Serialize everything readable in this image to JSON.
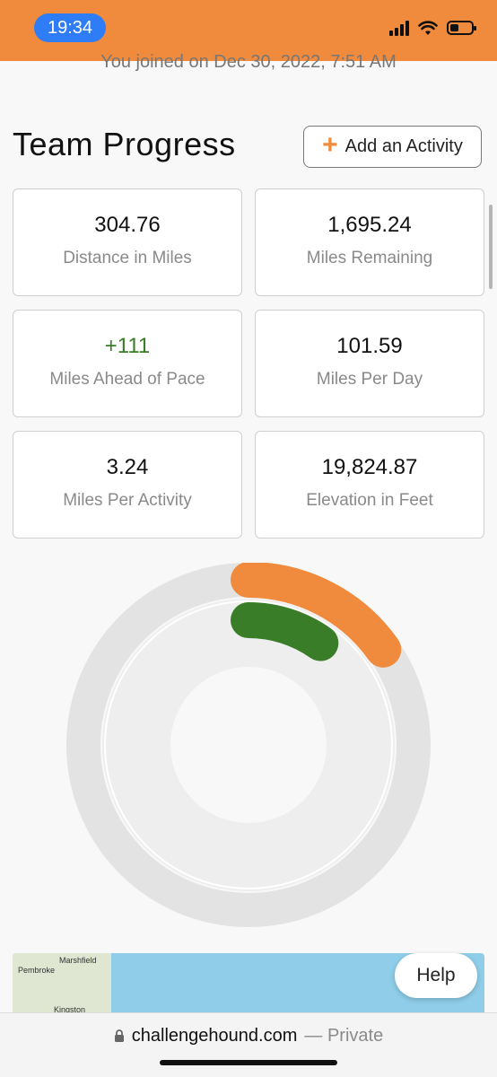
{
  "status_bar": {
    "time": "19:34"
  },
  "header": {
    "joined_text": "You joined on Dec 30, 2022, 7:51 AM"
  },
  "section": {
    "title": "Team Progress",
    "add_activity_label": "Add an Activity"
  },
  "stats": [
    {
      "value": "304.76",
      "label": "Distance in Miles"
    },
    {
      "value": "1,695.24",
      "label": "Miles Remaining"
    },
    {
      "value": "+111",
      "label": "Miles Ahead of Pace"
    },
    {
      "value": "101.59",
      "label": "Miles Per Day"
    },
    {
      "value": "3.24",
      "label": "Miles Per Activity"
    },
    {
      "value": "19,824.87",
      "label": "Elevation in Feet"
    }
  ],
  "progress_ring": {
    "outer_fraction": 0.152,
    "inner_fraction": 0.098,
    "colors": {
      "outer": "#f08a3c",
      "inner": "#3a7d28",
      "track_outer": "#e3e3e3",
      "track_inner": "#eeeeee"
    }
  },
  "map": {
    "labels": [
      "Marshfield",
      "Pembroke",
      "Kingston"
    ]
  },
  "help_label": "Help",
  "browser": {
    "domain": "challengehound.com",
    "mode": "— Private"
  }
}
